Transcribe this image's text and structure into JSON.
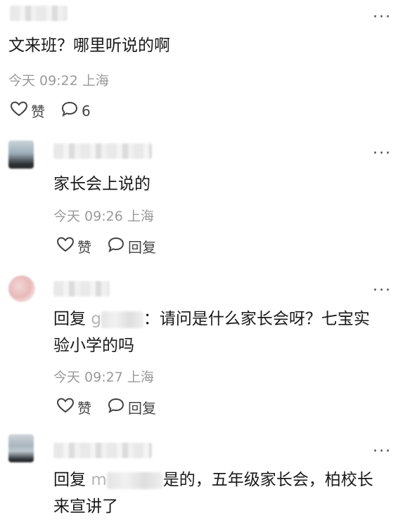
{
  "top_comment": {
    "text": "文来班？哪里听说的啊",
    "meta": "今天 09:22 上海",
    "like_label": "赞",
    "comment_count": "6",
    "more": "···"
  },
  "replies": [
    {
      "text": "家长会上说的",
      "meta": "今天 09:26 上海",
      "like_label": "赞",
      "reply_label": "回复",
      "more": "···"
    },
    {
      "reply_prefix": "回复",
      "mention_partial": "g",
      "text_after": "：请问是什么家长会呀？七宝实",
      "text_line2": "验小学的吗",
      "meta": "今天 09:27 上海",
      "like_label": "赞",
      "reply_label": "回复",
      "more": "···"
    },
    {
      "reply_prefix": "回复",
      "mention_partial": "m",
      "text_after": "是的，五年级家长会，柏校长",
      "text_line2": "来宣讲了",
      "more": "···"
    }
  ]
}
